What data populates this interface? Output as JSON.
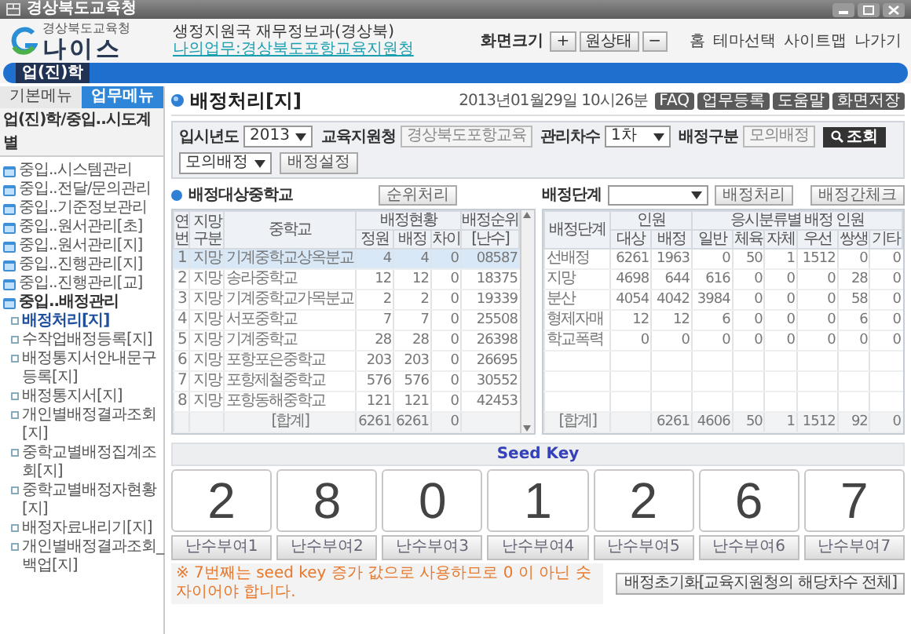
{
  "window": {
    "title": "경상북도교육청"
  },
  "header": {
    "logo_caption": "경상북도교육청",
    "logo_name": "나이스",
    "notices": [
      "생정지원국 재무정보과(경상북)",
      "나의업무:경상북도포항교육지원청"
    ],
    "zoom_label": "화면크기",
    "zoom_in": "+",
    "zoom_reset": "원상태",
    "zoom_out": "−",
    "links": [
      "홈",
      "테마선택",
      "사이트맵",
      "나가기"
    ]
  },
  "nav": {
    "tabs": [
      {
        "label": "업(진)학",
        "selected": true
      }
    ]
  },
  "sidebar": {
    "tabs": [
      {
        "label": "기본메뉴",
        "selected": false
      },
      {
        "label": "업무메뉴",
        "selected": true
      }
    ],
    "title": "업(진)학/중입..시도계별",
    "items": [
      {
        "label": "중입..시스템관리",
        "expanded": false
      },
      {
        "label": "중입..전달/문의관리",
        "expanded": false
      },
      {
        "label": "중입..기준정보관리",
        "expanded": false
      },
      {
        "label": "중입..원서관리[초]",
        "expanded": false
      },
      {
        "label": "중입..원서관리[지]",
        "expanded": false
      },
      {
        "label": "중입..진행관리[지]",
        "expanded": false
      },
      {
        "label": "중입..진행관리[교]",
        "expanded": false
      },
      {
        "label": "중입..배정관리",
        "expanded": true,
        "children": [
          {
            "label": "배정처리[지]",
            "selected": true
          },
          {
            "label": "수작업배정등록[지]",
            "selected": false
          },
          {
            "label": "배정통지서안내문구등록[지]",
            "selected": false
          },
          {
            "label": "배정통지서[지]",
            "selected": false
          },
          {
            "label": "개인별배정결과조회[지]",
            "selected": false
          },
          {
            "label": "중학교별배정집계조회[지]",
            "selected": false
          },
          {
            "label": "중학교별배정자현황[지]",
            "selected": false
          },
          {
            "label": "배정자료내리기[지]",
            "selected": false
          },
          {
            "label": "개인별배정결과조회_백업[지]",
            "selected": false
          }
        ]
      }
    ]
  },
  "page": {
    "title": "배정처리[지]",
    "datetime": "2013년01월29일 10시26분",
    "tools": [
      "FAQ",
      "업무등록",
      "도움말",
      "화면저장"
    ]
  },
  "filters": {
    "fields": [
      {
        "kind": "select",
        "label": "입시년도",
        "value": "2013"
      },
      {
        "kind": "text",
        "label": "교육지원청",
        "value": "경상북도포항교육",
        "disabled": true
      },
      {
        "kind": "select",
        "label": "관리차수",
        "value": "1차"
      },
      {
        "kind": "text",
        "label": "배정구분",
        "value": "모의배정",
        "disabled": true
      }
    ],
    "search_button": "조회",
    "mode_select": "모의배정",
    "settings_button": "배정설정"
  },
  "left_table": {
    "title": "배정대상중학교",
    "action": "순위처리",
    "columns": [
      "연번",
      "지망구분",
      "중학교",
      "배정현황",
      "배정순위",
      "정원",
      "배정",
      "차이",
      "[난수]"
    ],
    "rows": [
      {
        "no": "1",
        "choice": "지망",
        "school": "기계중학교상옥분교",
        "quota": "4",
        "assigned": "4",
        "diff": "0",
        "rank": "08587",
        "selected": true
      },
      {
        "no": "2",
        "choice": "지망",
        "school": "송라중학교",
        "quota": "12",
        "assigned": "12",
        "diff": "0",
        "rank": "18375",
        "selected": false
      },
      {
        "no": "3",
        "choice": "지망",
        "school": "기계중학교가목분교",
        "quota": "2",
        "assigned": "2",
        "diff": "0",
        "rank": "19339",
        "selected": false
      },
      {
        "no": "4",
        "choice": "지망",
        "school": "서포중학교",
        "quota": "7",
        "assigned": "7",
        "diff": "0",
        "rank": "25508",
        "selected": false
      },
      {
        "no": "5",
        "choice": "지망",
        "school": "기계중학교",
        "quota": "28",
        "assigned": "28",
        "diff": "0",
        "rank": "26398",
        "selected": false
      },
      {
        "no": "6",
        "choice": "지망",
        "school": "포항포은중학교",
        "quota": "203",
        "assigned": "203",
        "diff": "0",
        "rank": "26695",
        "selected": false
      },
      {
        "no": "7",
        "choice": "지망",
        "school": "포항제철중학교",
        "quota": "576",
        "assigned": "576",
        "diff": "0",
        "rank": "30552",
        "selected": false
      },
      {
        "no": "8",
        "choice": "지망",
        "school": "포항동해중학교",
        "quota": "121",
        "assigned": "121",
        "diff": "0",
        "rank": "42453",
        "selected": false
      }
    ],
    "total": {
      "label": "[합계]",
      "quota": "6261",
      "assigned": "6261",
      "diff": "0"
    }
  },
  "right_table": {
    "stage_label": "배정단계",
    "action": "배정처리",
    "check_button": "배정간체크",
    "columns": [
      "배정단계",
      "인원",
      "응시분류별 배정 인원",
      "대상",
      "배정",
      "일반",
      "체육",
      "자체",
      "우선",
      "쌍생",
      "기타"
    ],
    "rows": [
      {
        "stage": "선배정",
        "values": [
          "6261",
          "1963",
          "0",
          "50",
          "1",
          "1512",
          "0",
          "0"
        ]
      },
      {
        "stage": "지망",
        "values": [
          "4698",
          "644",
          "616",
          "0",
          "0",
          "0",
          "28",
          "0"
        ]
      },
      {
        "stage": "분산",
        "values": [
          "4054",
          "4042",
          "3984",
          "0",
          "0",
          "0",
          "58",
          "0"
        ]
      },
      {
        "stage": "형제자매",
        "values": [
          "12",
          "12",
          "6",
          "0",
          "0",
          "0",
          "6",
          "0"
        ]
      },
      {
        "stage": "학교폭력",
        "values": [
          "0",
          "0",
          "0",
          "0",
          "0",
          "0",
          "0",
          "0"
        ]
      }
    ],
    "total": {
      "label": "[합계]",
      "values": [
        "6261",
        "4606",
        "50",
        "1",
        "1512",
        "92",
        "0"
      ]
    }
  },
  "seed": {
    "title": "Seed Key",
    "digits": [
      {
        "value": "2",
        "button": "난수부여1"
      },
      {
        "value": "8",
        "button": "난수부여2"
      },
      {
        "value": "0",
        "button": "난수부여3"
      },
      {
        "value": "1",
        "button": "난수부여4"
      },
      {
        "value": "2",
        "button": "난수부여5"
      },
      {
        "value": "6",
        "button": "난수부여6"
      },
      {
        "value": "7",
        "button": "난수부여7"
      }
    ],
    "note": "※ 7번째는 seed key 증가 값으로 사용하므로 0 이 아닌 숫자이어야 합니다.",
    "reset_button": "배정초기화[교육지원청의 해당차수 전체]"
  }
}
